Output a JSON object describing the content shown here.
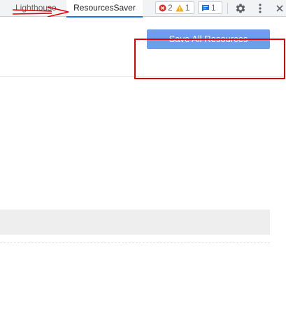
{
  "tabs": {
    "lighthouse": "Lighthouse",
    "resources_saver": "ResourcesSaver"
  },
  "counters": {
    "errors": "2",
    "warnings": "1",
    "issues": "1"
  },
  "toolbar": {
    "settings_icon": "gear-icon",
    "more_icon": "kebab-menu-icon",
    "close_icon": "close-icon"
  },
  "panel": {
    "save_button_label": "Save All Resources"
  },
  "colors": {
    "accent": "#1a73e8",
    "button": "#6d9eeb",
    "annotation": "#e00000",
    "error": "#d93025",
    "warning": "#f9ab00"
  }
}
